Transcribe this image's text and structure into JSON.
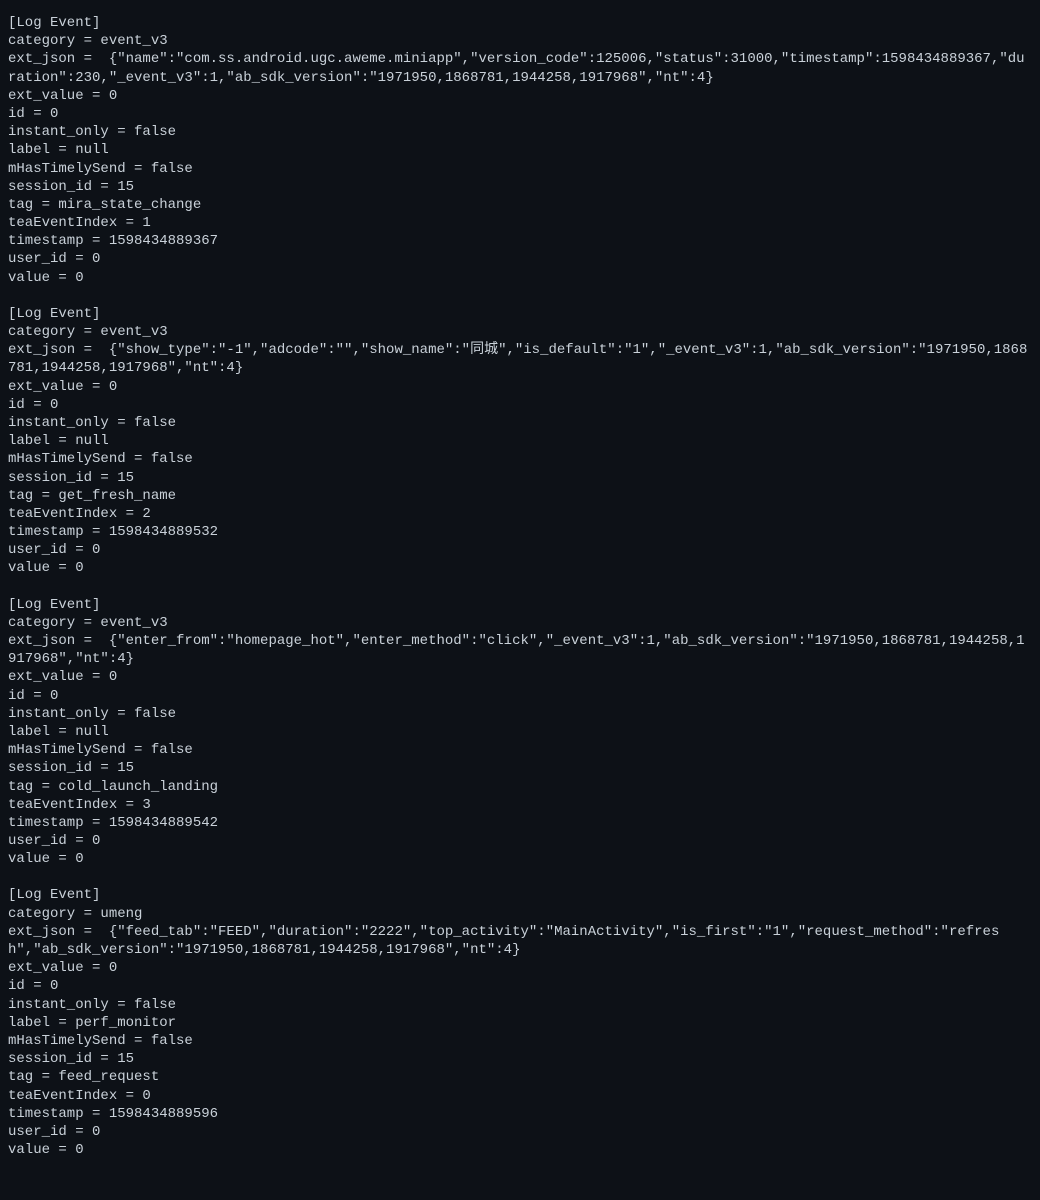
{
  "events": [
    {
      "header": "[Log Event]",
      "fields": [
        {
          "key": "category",
          "value": "event_v3"
        },
        {
          "key": "ext_json",
          "value": " {\"name\":\"com.ss.android.ugc.aweme.miniapp\",\"version_code\":125006,\"status\":31000,\"timestamp\":1598434889367,\"duration\":230,\"_event_v3\":1,\"ab_sdk_version\":\"1971950,1868781,1944258,1917968\",\"nt\":4}"
        },
        {
          "key": "ext_value",
          "value": "0"
        },
        {
          "key": "id",
          "value": "0"
        },
        {
          "key": "instant_only",
          "value": "false"
        },
        {
          "key": "label",
          "value": "null"
        },
        {
          "key": "mHasTimelySend",
          "value": "false"
        },
        {
          "key": "session_id",
          "value": "15"
        },
        {
          "key": "tag",
          "value": "mira_state_change"
        },
        {
          "key": "teaEventIndex",
          "value": "1"
        },
        {
          "key": "timestamp",
          "value": "1598434889367"
        },
        {
          "key": "user_id",
          "value": "0"
        },
        {
          "key": "value",
          "value": "0"
        }
      ]
    },
    {
      "header": "[Log Event]",
      "fields": [
        {
          "key": "category",
          "value": "event_v3"
        },
        {
          "key": "ext_json",
          "value": " {\"show_type\":\"-1\",\"adcode\":\"\",\"show_name\":\"同城\",\"is_default\":\"1\",\"_event_v3\":1,\"ab_sdk_version\":\"1971950,1868781,1944258,1917968\",\"nt\":4}"
        },
        {
          "key": "ext_value",
          "value": "0"
        },
        {
          "key": "id",
          "value": "0"
        },
        {
          "key": "instant_only",
          "value": "false"
        },
        {
          "key": "label",
          "value": "null"
        },
        {
          "key": "mHasTimelySend",
          "value": "false"
        },
        {
          "key": "session_id",
          "value": "15"
        },
        {
          "key": "tag",
          "value": "get_fresh_name"
        },
        {
          "key": "teaEventIndex",
          "value": "2"
        },
        {
          "key": "timestamp",
          "value": "1598434889532"
        },
        {
          "key": "user_id",
          "value": "0"
        },
        {
          "key": "value",
          "value": "0"
        }
      ]
    },
    {
      "header": "[Log Event]",
      "fields": [
        {
          "key": "category",
          "value": "event_v3"
        },
        {
          "key": "ext_json",
          "value": " {\"enter_from\":\"homepage_hot\",\"enter_method\":\"click\",\"_event_v3\":1,\"ab_sdk_version\":\"1971950,1868781,1944258,1917968\",\"nt\":4}"
        },
        {
          "key": "ext_value",
          "value": "0"
        },
        {
          "key": "id",
          "value": "0"
        },
        {
          "key": "instant_only",
          "value": "false"
        },
        {
          "key": "label",
          "value": "null"
        },
        {
          "key": "mHasTimelySend",
          "value": "false"
        },
        {
          "key": "session_id",
          "value": "15"
        },
        {
          "key": "tag",
          "value": "cold_launch_landing"
        },
        {
          "key": "teaEventIndex",
          "value": "3"
        },
        {
          "key": "timestamp",
          "value": "1598434889542"
        },
        {
          "key": "user_id",
          "value": "0"
        },
        {
          "key": "value",
          "value": "0"
        }
      ]
    },
    {
      "header": "[Log Event]",
      "fields": [
        {
          "key": "category",
          "value": "umeng"
        },
        {
          "key": "ext_json",
          "value": " {\"feed_tab\":\"FEED\",\"duration\":\"2222\",\"top_activity\":\"MainActivity\",\"is_first\":\"1\",\"request_method\":\"refresh\",\"ab_sdk_version\":\"1971950,1868781,1944258,1917968\",\"nt\":4}"
        },
        {
          "key": "ext_value",
          "value": "0"
        },
        {
          "key": "id",
          "value": "0"
        },
        {
          "key": "instant_only",
          "value": "false"
        },
        {
          "key": "label",
          "value": "perf_monitor"
        },
        {
          "key": "mHasTimelySend",
          "value": "false"
        },
        {
          "key": "session_id",
          "value": "15"
        },
        {
          "key": "tag",
          "value": "feed_request"
        },
        {
          "key": "teaEventIndex",
          "value": "0"
        },
        {
          "key": "timestamp",
          "value": "1598434889596"
        },
        {
          "key": "user_id",
          "value": "0"
        },
        {
          "key": "value",
          "value": "0"
        }
      ]
    }
  ]
}
